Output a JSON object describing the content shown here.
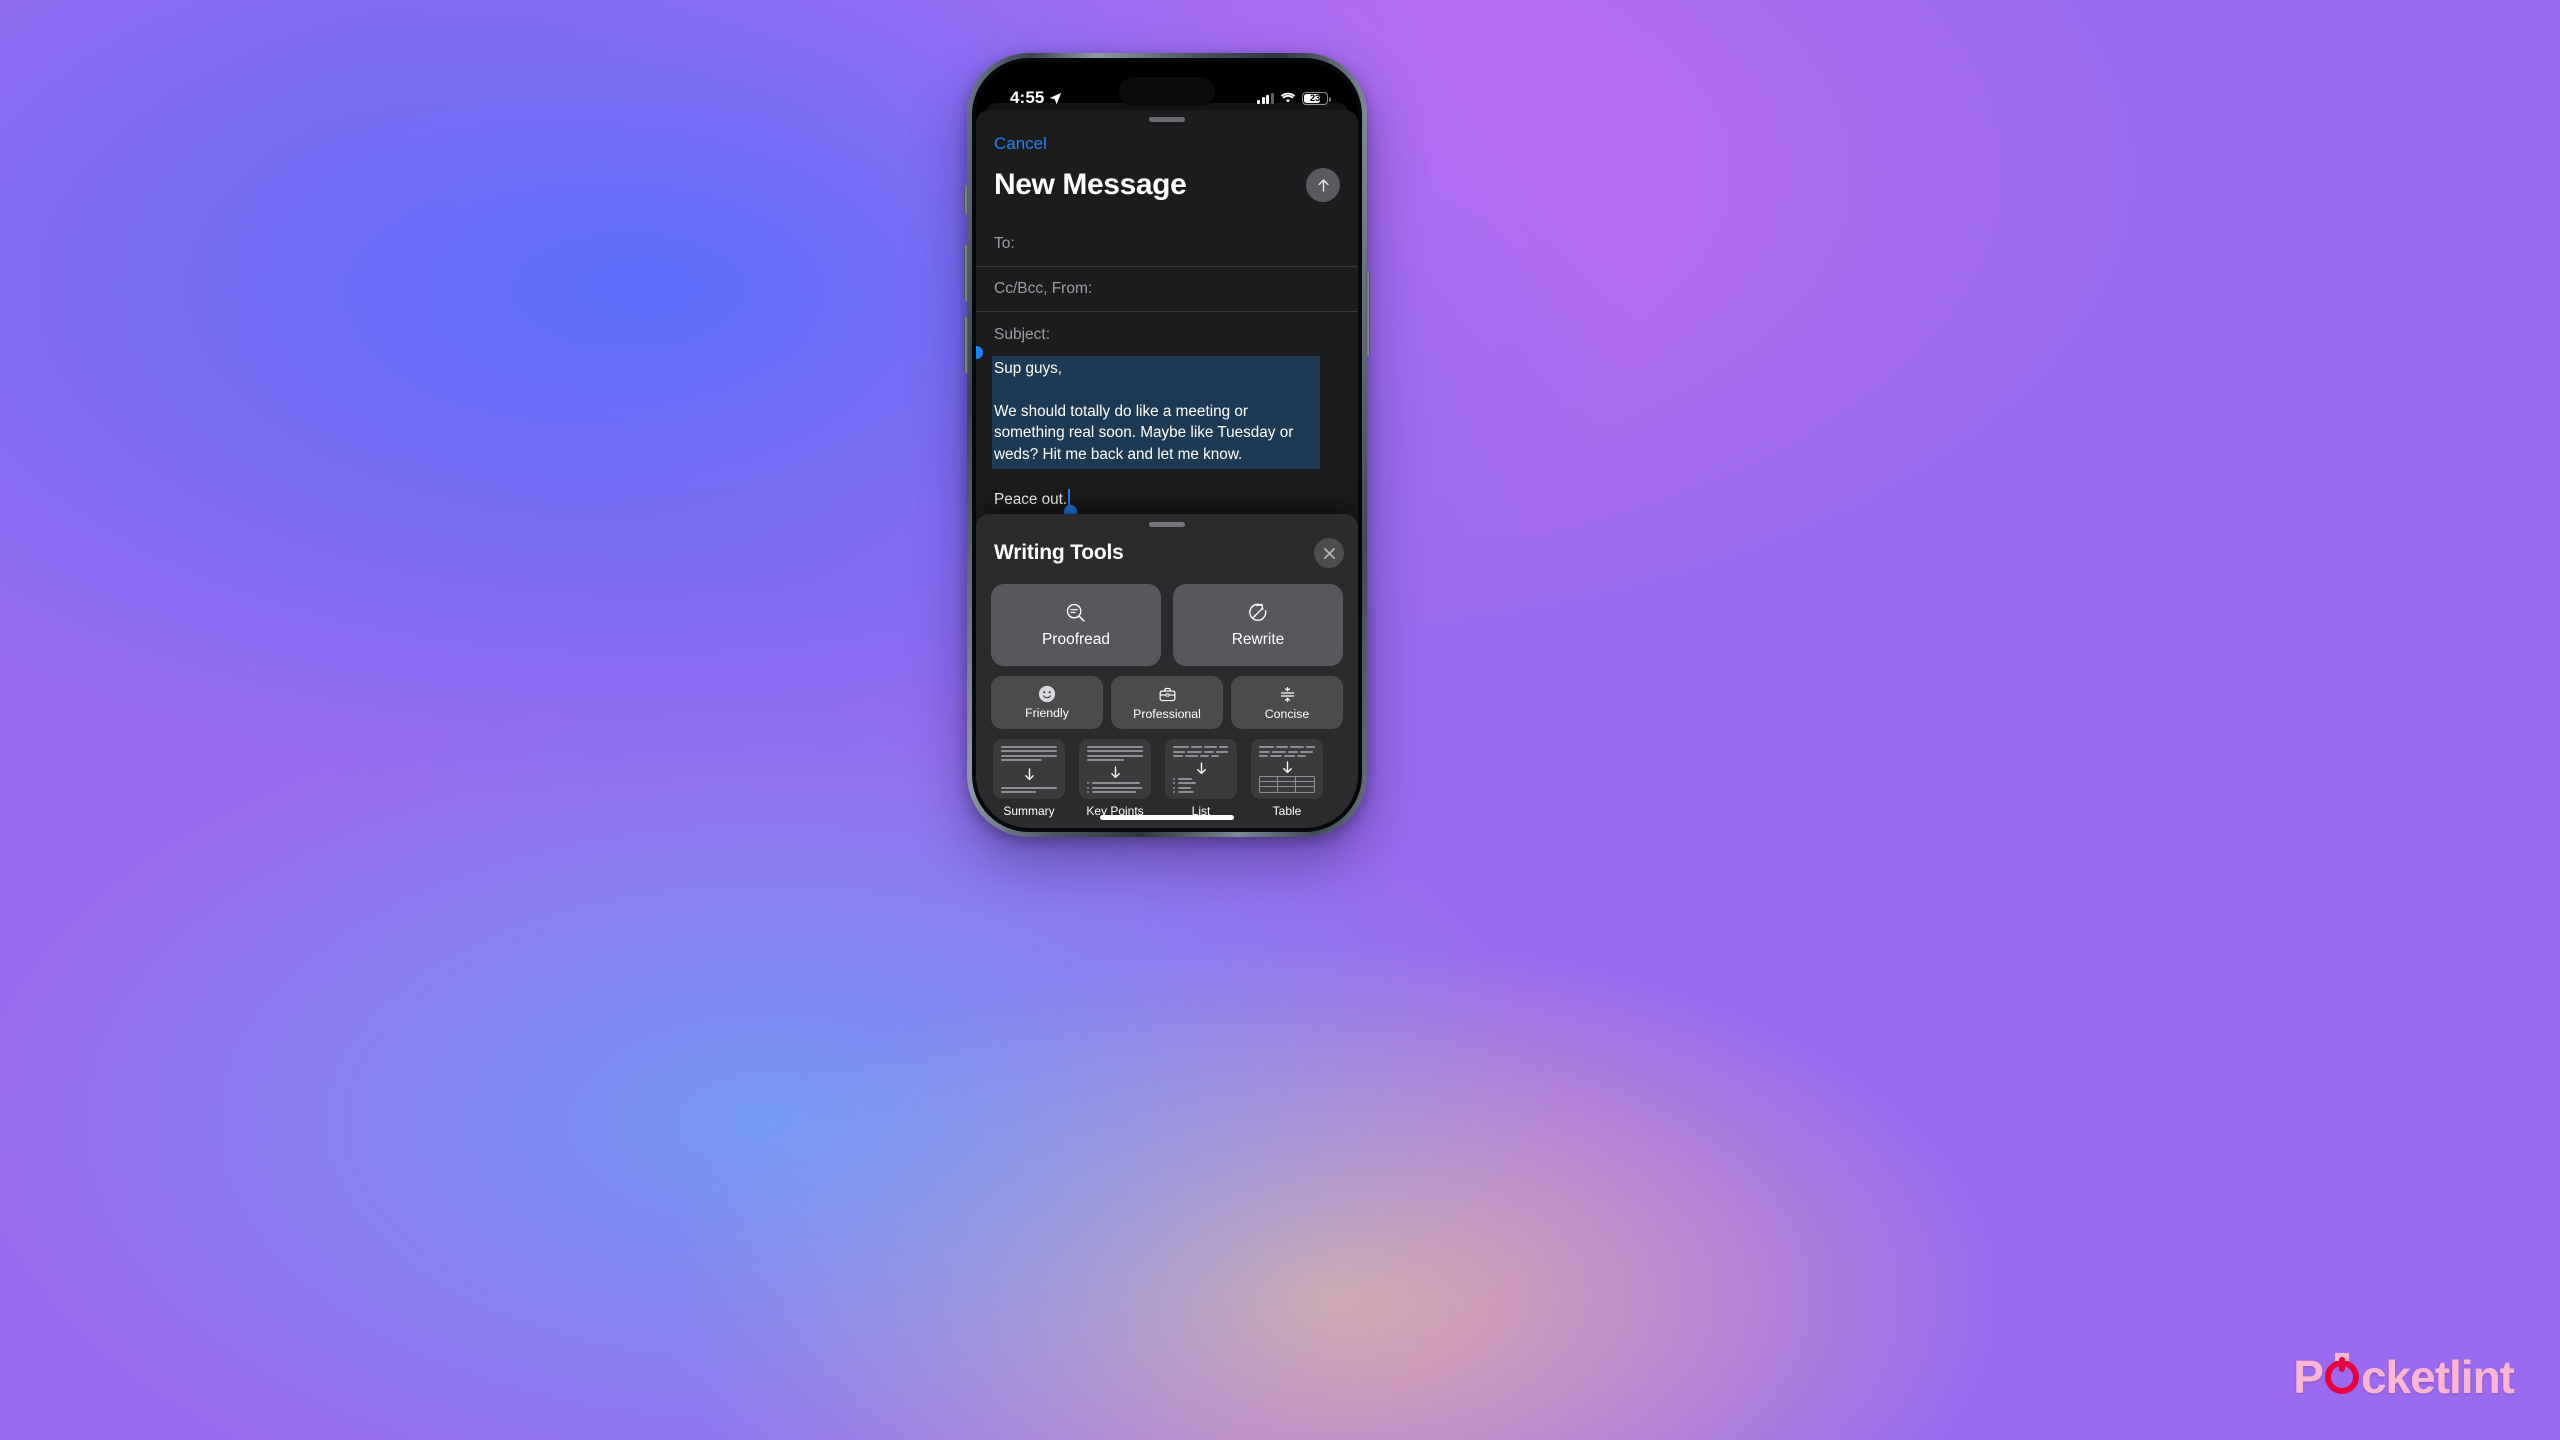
{
  "device": {
    "status_bar": {
      "time": "4:55",
      "location_icon": "location-arrow-icon",
      "cellular_icon": "cellular-bars-icon",
      "wifi_icon": "wifi-icon",
      "battery_percent": "23"
    }
  },
  "compose": {
    "cancel_label": "Cancel",
    "title": "New Message",
    "send_icon": "arrow-up-icon",
    "fields": {
      "to_label": "To:",
      "cc_label": "Cc/Bcc, From:",
      "subject_label": "Subject:"
    },
    "body": {
      "greeting": "Sup guys,",
      "paragraph": "We should totally do like a meeting or something real soon. Maybe like Tuesday or weds? Hit me back and let me know.",
      "closing": "Peace out."
    },
    "selection_color": "#1d3a54",
    "accent_color": "#1E83F7"
  },
  "writing_tools": {
    "title": "Writing Tools",
    "close_icon": "close-icon",
    "actions": [
      {
        "label": "Proofread",
        "icon": "magnifier-text-icon"
      },
      {
        "label": "Rewrite",
        "icon": "circular-arrow-pen-icon"
      }
    ],
    "tones": [
      {
        "label": "Friendly",
        "icon": "smiley-face-icon"
      },
      {
        "label": "Professional",
        "icon": "briefcase-icon"
      },
      {
        "label": "Concise",
        "icon": "compress-arrows-icon"
      }
    ],
    "transforms": [
      {
        "label": "Summary",
        "icon": "summary-thumbnail-icon"
      },
      {
        "label": "Key Points",
        "icon": "key-points-thumbnail-icon"
      },
      {
        "label": "List",
        "icon": "list-thumbnail-icon"
      },
      {
        "label": "Table",
        "icon": "table-thumbnail-icon"
      }
    ]
  },
  "watermark": {
    "prefix": "P",
    "suffix": "cketlint"
  }
}
